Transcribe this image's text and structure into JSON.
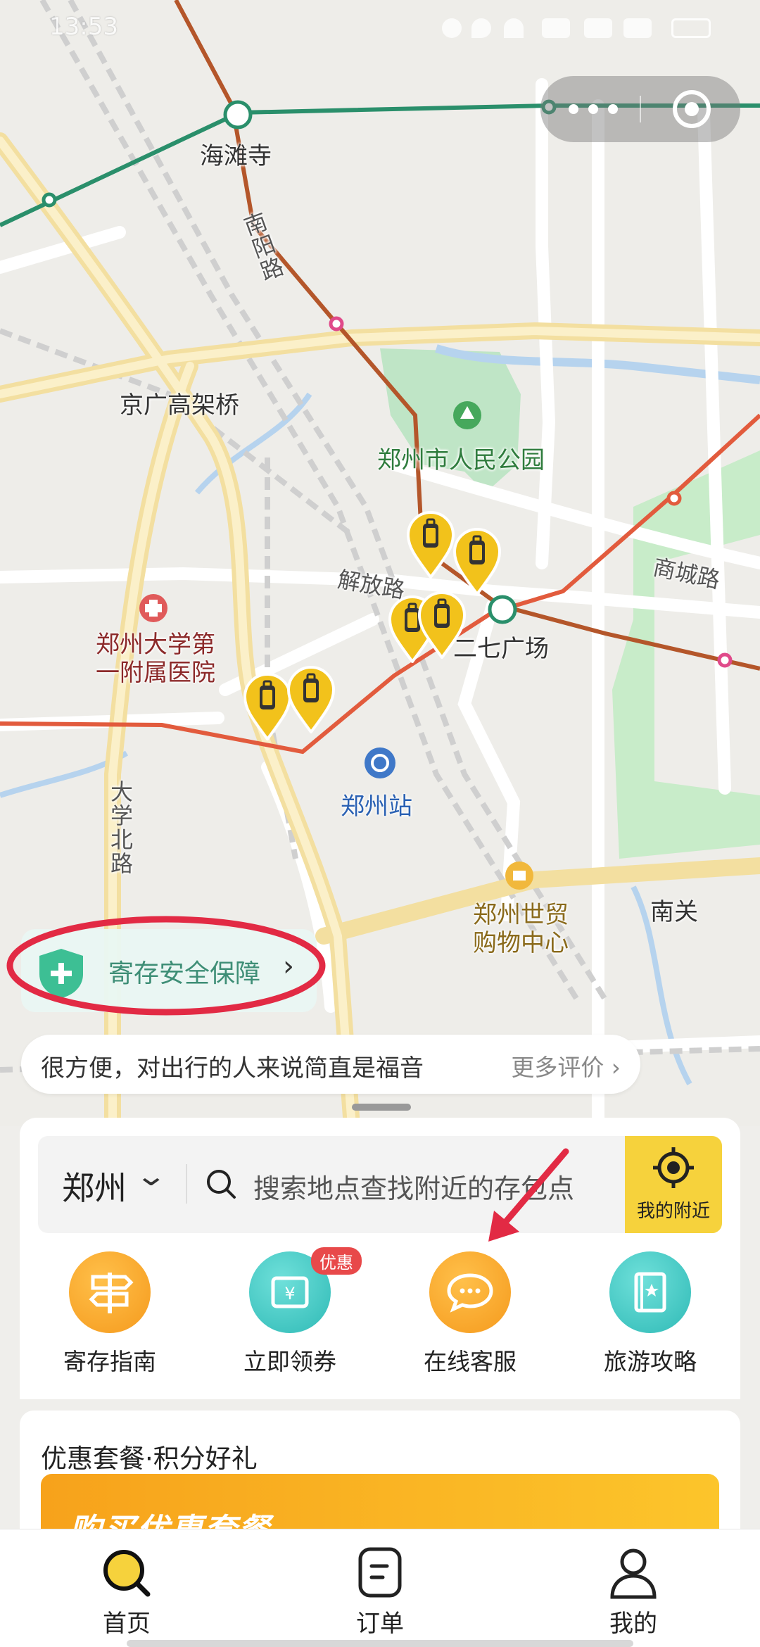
{
  "status_bar": {
    "time": "13:53"
  },
  "map": {
    "labels": {
      "haitansi": "海滩寺",
      "nanyang_road": "南阳路",
      "jingguang_bridge": "京广高架桥",
      "peoples_park": "郑州市人民公园",
      "jiefang_road": "解放路",
      "shangcheng_road": "商城路",
      "erqi_square": "二七广场",
      "hospital": "郑州大学第一附属医院",
      "zhengzhou_station": "郑州站",
      "daxue_north_road": "大学北路",
      "world_trade": "郑州世贸购物中心",
      "nanguan": "南关"
    }
  },
  "safety_banner": {
    "label": "寄存安全保障"
  },
  "review": {
    "text": "很方便，对出行的人来说简直是福音",
    "more": "更多评价"
  },
  "search": {
    "city": "郑州",
    "placeholder": "搜索地点查找附近的存包点",
    "nearby_label": "我的附近"
  },
  "services": [
    {
      "label": "寄存指南",
      "icon": "signpost-icon",
      "color": "#f5a123"
    },
    {
      "label": "立即领券",
      "icon": "coupon-icon",
      "color": "#3cc8c4",
      "badge": "优惠"
    },
    {
      "label": "在线客服",
      "icon": "chat-icon",
      "color": "#f5a123"
    },
    {
      "label": "旅游攻略",
      "icon": "guidebook-icon",
      "color": "#3cc8c4"
    }
  ],
  "promo": {
    "title": "优惠套餐·积分好礼",
    "banner_text": "购买优惠套餐"
  },
  "tabs": [
    {
      "label": "首页",
      "active": true
    },
    {
      "label": "订单",
      "active": false
    },
    {
      "label": "我的",
      "active": false
    }
  ],
  "colors": {
    "accent_yellow": "#f6d23c",
    "annotation_red": "#e22a44"
  }
}
